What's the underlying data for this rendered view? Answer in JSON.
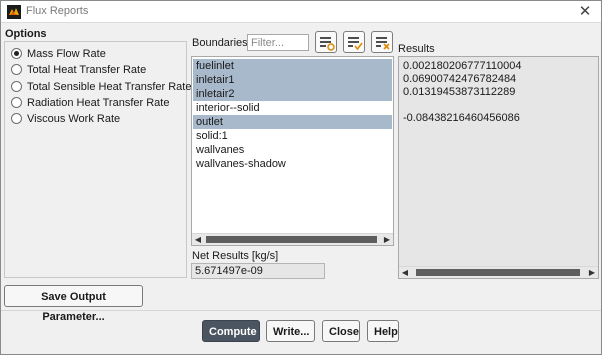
{
  "window": {
    "title": "Flux Reports",
    "close_glyph": "✕"
  },
  "options": {
    "title": "Options",
    "items": [
      {
        "label": "Mass Flow Rate",
        "checked": true
      },
      {
        "label": "Total Heat Transfer Rate",
        "checked": false
      },
      {
        "label": "Total Sensible Heat Transfer Rate",
        "checked": false
      },
      {
        "label": "Radiation Heat Transfer Rate",
        "checked": false
      },
      {
        "label": "Viscous Work Rate",
        "checked": false
      }
    ]
  },
  "boundaries": {
    "label": "Boundaries",
    "filter_placeholder": "Filter...",
    "toolbar_icons": [
      "select-all-icon",
      "check-list-icon",
      "deselect-all-icon"
    ],
    "items": [
      {
        "name": "fuelinlet",
        "selected": true
      },
      {
        "name": "inletair1",
        "selected": true
      },
      {
        "name": "inletair2",
        "selected": true
      },
      {
        "name": "interior--solid",
        "selected": false
      },
      {
        "name": "outlet",
        "selected": true
      },
      {
        "name": "solid:1",
        "selected": false
      },
      {
        "name": "wallvanes",
        "selected": false
      },
      {
        "name": "wallvanes-shadow",
        "selected": false
      }
    ]
  },
  "results": {
    "label": "Results",
    "lines": [
      "0.002180206777110004",
      "0.06900742476782484",
      "0.01319453873112289",
      "",
      "-0.08438216460456086"
    ]
  },
  "net_results": {
    "label": "Net Results [kg/s]",
    "value": "5.671497e-09"
  },
  "buttons": {
    "save_output": "Save Output Parameter...",
    "compute": "Compute",
    "write": "Write...",
    "close": "Close",
    "help": "Help"
  },
  "colors": {
    "selection": "#a8b9cc",
    "primary_button": "#4a5561",
    "results_bg": "#e6e6e6"
  }
}
